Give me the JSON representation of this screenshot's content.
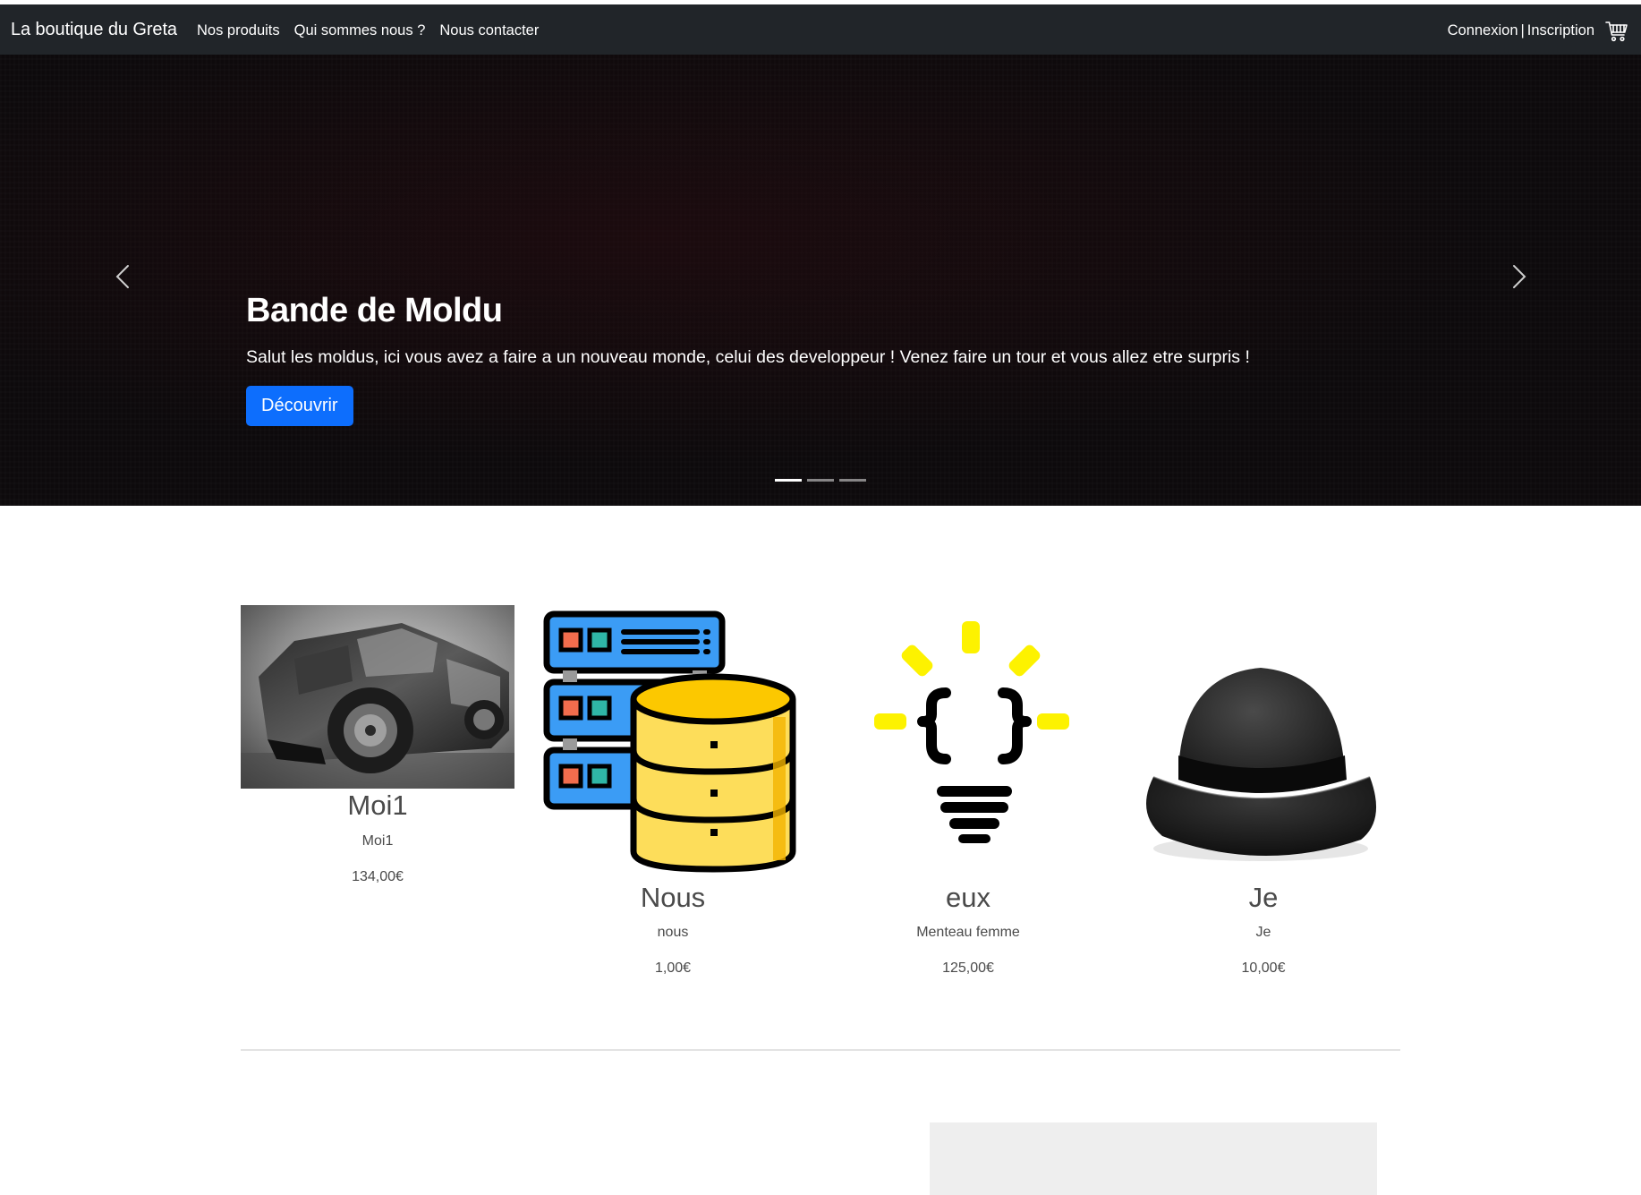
{
  "navbar": {
    "brand": "La boutique du Greta",
    "links": [
      "Nos produits",
      "Qui sommes nous ?",
      "Nous contacter"
    ],
    "login": "Connexion",
    "separator": "|",
    "register": "Inscription",
    "cart_icon": "cart-icon"
  },
  "carousel": {
    "title": "Bande de Moldu",
    "text": "Salut les moldus, ici vous avez a faire a un nouveau monde, celui des developpeur ! Venez faire un tour et vous allez etre surpris !",
    "button": "Découvrir",
    "slide_count": 3,
    "active_slide": 1,
    "prev_icon": "chevron-left-icon",
    "next_icon": "chevron-right-icon"
  },
  "products": [
    {
      "name": "Moi1",
      "desc": "Moi1",
      "price": "134,00€",
      "image": "car-photo"
    },
    {
      "name": "Nous",
      "desc": "nous",
      "price": "1,00€",
      "image": "server-database-icon"
    },
    {
      "name": "eux",
      "desc": "Menteau femme",
      "price": "125,00€",
      "image": "code-lightbulb-icon"
    },
    {
      "name": "Je",
      "desc": "Je",
      "price": "10,00€",
      "image": "bowler-hat-photo"
    }
  ],
  "colors": {
    "navbar_bg": "#212529",
    "primary": "#0d6efd",
    "db_yellow": "#fcd73f",
    "server_blue": "#3b9cf5",
    "bulb_yellow": "#fdf200"
  }
}
